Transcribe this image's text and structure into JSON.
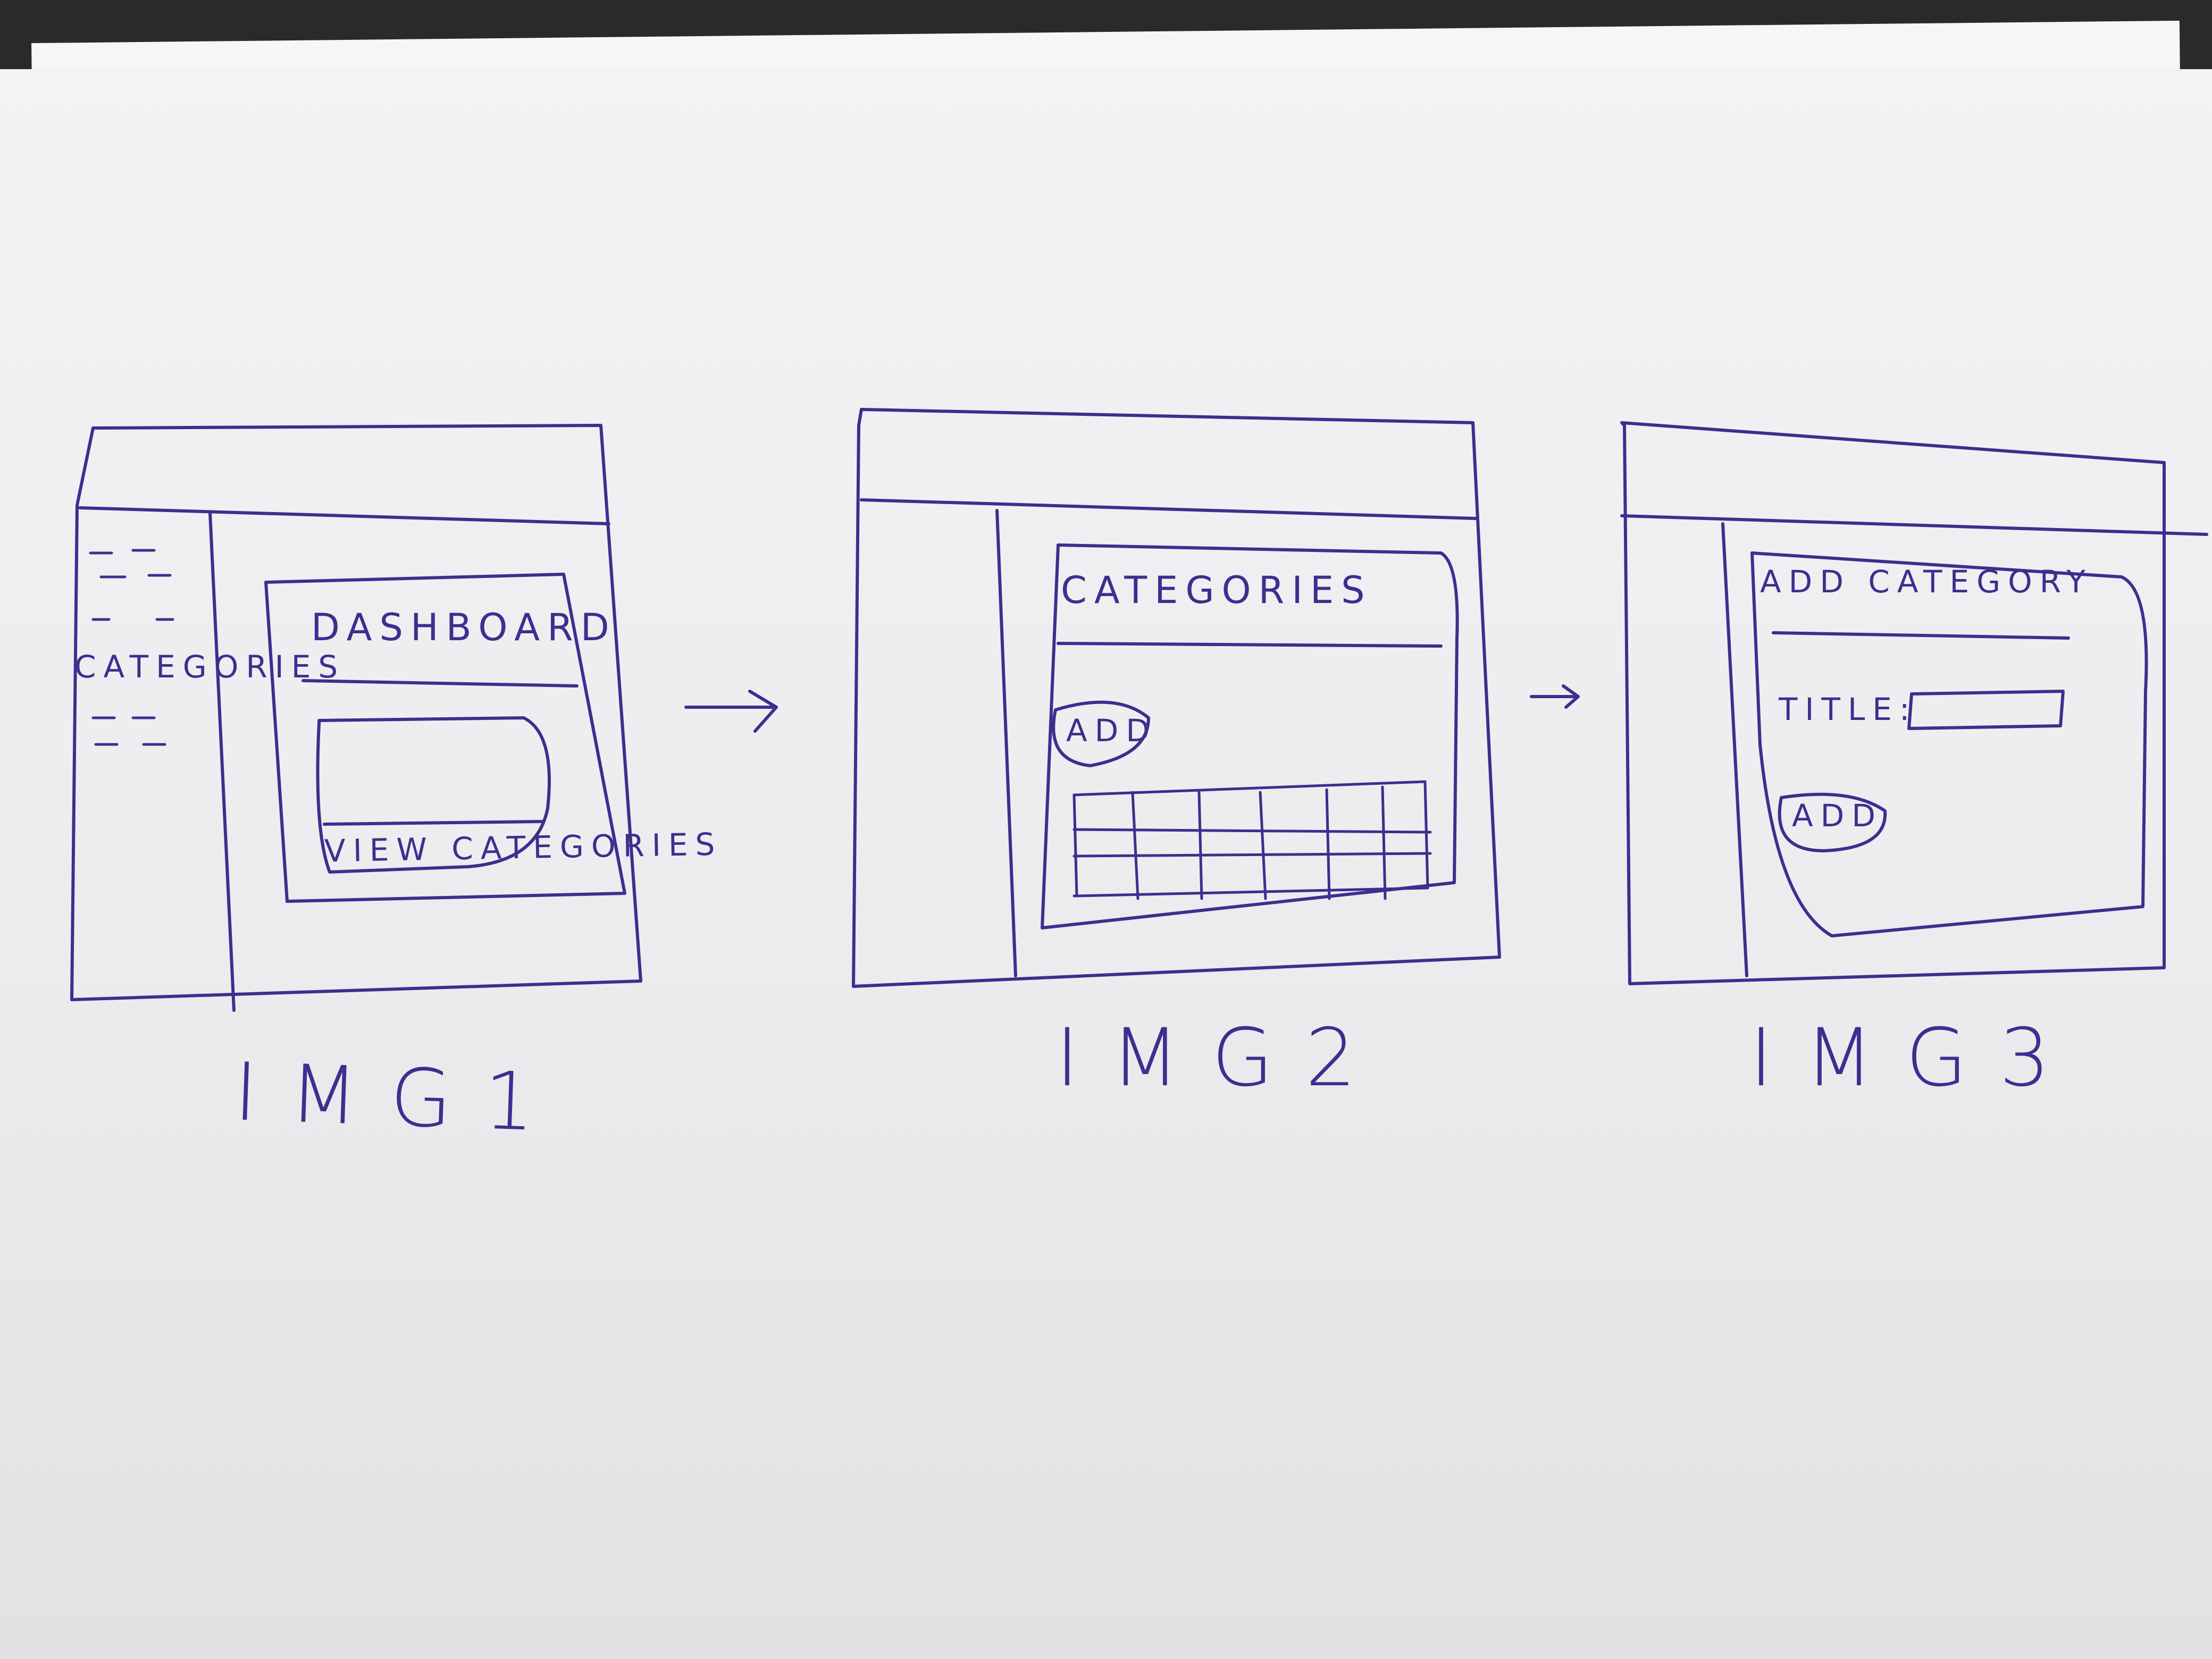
{
  "frames": [
    {
      "id": "img1",
      "caption": "IMG1",
      "sidebar_item": "CATEGORIES",
      "card_title": "DASHBOARD",
      "card_link": "VIEW CATEGORIES"
    },
    {
      "id": "img2",
      "caption": "IMG2",
      "card_title": "CATEGORIES",
      "add_button": "ADD",
      "table": {
        "rows": 3,
        "cols": 6
      }
    },
    {
      "id": "img3",
      "caption": "IMG3",
      "card_title": "ADD CATEGORY",
      "field_label": "TITLE:",
      "add_button": "ADD"
    }
  ],
  "colors": {
    "ink": "#3b2f8f",
    "paper": "#f0f0f2",
    "background": "#2a2a2a"
  }
}
